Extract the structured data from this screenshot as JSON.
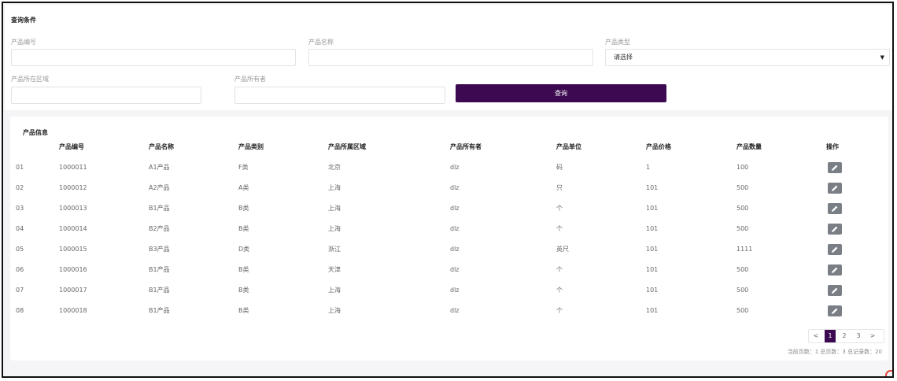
{
  "query": {
    "title": "查询条件",
    "fields": {
      "product_code_label": "产品编号",
      "product_name_label": "产品名称",
      "product_type_label": "产品类型",
      "product_type_selected": "请选择",
      "region_label": "产品所在区域",
      "owner_label": "产品所有者"
    },
    "search_button": "查询"
  },
  "info": {
    "title": "产品信息",
    "columns": [
      "",
      "产品编号",
      "产品名称",
      "产品类别",
      "产品所属区域",
      "产品所有者",
      "产品单位",
      "产品价格",
      "产品数量",
      "操作"
    ],
    "rows": [
      [
        "01",
        "1000011",
        "A1产品",
        "F类",
        "北京",
        "dlz",
        "码",
        "1",
        "100"
      ],
      [
        "02",
        "1000012",
        "A2产品",
        "A类",
        "上海",
        "dlz",
        "只",
        "101",
        "500"
      ],
      [
        "03",
        "1000013",
        "B1产品",
        "B类",
        "上海",
        "dlz",
        "个",
        "101",
        "500"
      ],
      [
        "04",
        "1000014",
        "B2产品",
        "B类",
        "上海",
        "dlz",
        "个",
        "101",
        "500"
      ],
      [
        "05",
        "1000015",
        "B3产品",
        "D类",
        "浙江",
        "dlz",
        "英尺",
        "101",
        "1111"
      ],
      [
        "06",
        "1000016",
        "B1产品",
        "B类",
        "天津",
        "dlz",
        "个",
        "101",
        "500"
      ],
      [
        "07",
        "1000017",
        "B1产品",
        "B类",
        "上海",
        "dlz",
        "个",
        "101",
        "500"
      ],
      [
        "08",
        "1000018",
        "B1产品",
        "B类",
        "上海",
        "dlz",
        "个",
        "101",
        "500"
      ]
    ],
    "edit_icon": "pencil-icon"
  },
  "pagination": {
    "prev": "<",
    "pages": [
      "1",
      "2",
      "3"
    ],
    "next": ">",
    "info": "当前页数：1 总页数：3 总记录数：20"
  },
  "colors": {
    "primary": "#3d0a52",
    "edit_button": "#7a7f86"
  }
}
